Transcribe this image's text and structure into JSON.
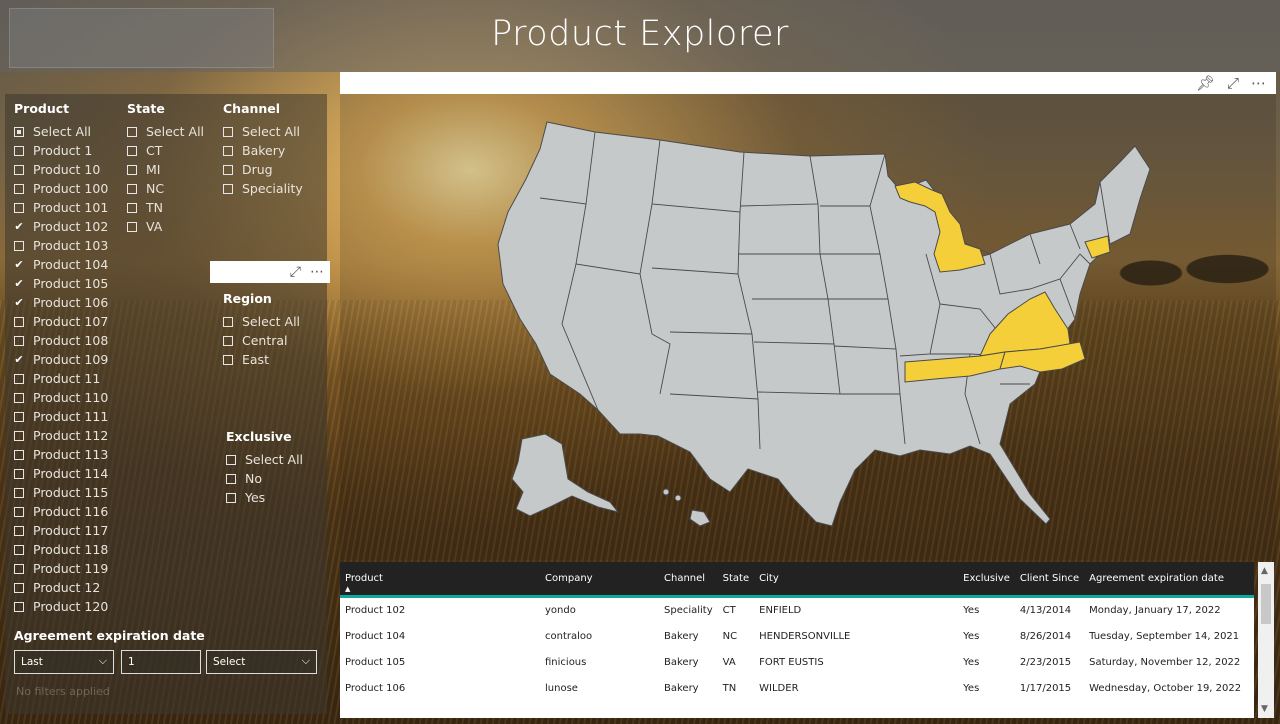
{
  "header": {
    "title": "Product Explorer"
  },
  "slicers": {
    "product": {
      "title": "Product",
      "items": [
        {
          "label": "Select All",
          "state": "partial"
        },
        {
          "label": "Product 1",
          "state": "off"
        },
        {
          "label": "Product 10",
          "state": "off"
        },
        {
          "label": "Product 100",
          "state": "off"
        },
        {
          "label": "Product 101",
          "state": "off"
        },
        {
          "label": "Product 102",
          "state": "on"
        },
        {
          "label": "Product 103",
          "state": "off"
        },
        {
          "label": "Product 104",
          "state": "on"
        },
        {
          "label": "Product 105",
          "state": "on"
        },
        {
          "label": "Product 106",
          "state": "on"
        },
        {
          "label": "Product 107",
          "state": "off"
        },
        {
          "label": "Product 108",
          "state": "off"
        },
        {
          "label": "Product 109",
          "state": "on"
        },
        {
          "label": "Product 11",
          "state": "off"
        },
        {
          "label": "Product 110",
          "state": "off"
        },
        {
          "label": "Product 111",
          "state": "off"
        },
        {
          "label": "Product 112",
          "state": "off"
        },
        {
          "label": "Product 113",
          "state": "off"
        },
        {
          "label": "Product 114",
          "state": "off"
        },
        {
          "label": "Product 115",
          "state": "off"
        },
        {
          "label": "Product 116",
          "state": "off"
        },
        {
          "label": "Product 117",
          "state": "off"
        },
        {
          "label": "Product 118",
          "state": "off"
        },
        {
          "label": "Product 119",
          "state": "off"
        },
        {
          "label": "Product 12",
          "state": "off"
        },
        {
          "label": "Product 120",
          "state": "off"
        }
      ]
    },
    "state": {
      "title": "State",
      "items": [
        {
          "label": "Select All",
          "state": "off"
        },
        {
          "label": "CT",
          "state": "off"
        },
        {
          "label": "MI",
          "state": "off"
        },
        {
          "label": "NC",
          "state": "off"
        },
        {
          "label": "TN",
          "state": "off"
        },
        {
          "label": "VA",
          "state": "off"
        }
      ]
    },
    "channel": {
      "title": "Channel",
      "items": [
        {
          "label": "Select All",
          "state": "off"
        },
        {
          "label": "Bakery",
          "state": "off"
        },
        {
          "label": "Drug",
          "state": "off"
        },
        {
          "label": "Speciality",
          "state": "off"
        }
      ]
    },
    "region": {
      "title": "Region",
      "items": [
        {
          "label": "Select All",
          "state": "off"
        },
        {
          "label": "Central",
          "state": "off"
        },
        {
          "label": "East",
          "state": "off"
        }
      ]
    },
    "exclusive": {
      "title": "Exclusive",
      "items": [
        {
          "label": "Select All",
          "state": "off"
        },
        {
          "label": "No",
          "state": "off"
        },
        {
          "label": "Yes",
          "state": "off"
        }
      ]
    }
  },
  "agreement_filter": {
    "title": "Agreement expiration date",
    "operator": "Last",
    "value": "1",
    "unit_placeholder": "Select",
    "status": "No filters applied"
  },
  "icons": {
    "pin": "pin-icon",
    "focus": "focus-mode-icon",
    "more": "more-options-icon"
  },
  "colors": {
    "highlight_state": "#f5cf3a",
    "base_state": "#c6c9ca",
    "table_header_bg": "#222222",
    "table_accent": "#11a8a0"
  },
  "map": {
    "highlighted_states": [
      "MI",
      "CT",
      "NC",
      "TN",
      "VA"
    ]
  },
  "table": {
    "columns": [
      "Product",
      "Company",
      "Channel",
      "State",
      "City",
      "Exclusive",
      "Client Since",
      "Agreement expiration date"
    ],
    "rows": [
      [
        "Product 102",
        "yondo",
        "Speciality",
        "CT",
        "ENFIELD",
        "Yes",
        "4/13/2014",
        "Monday, January 17, 2022"
      ],
      [
        "Product 104",
        "contraloo",
        "Bakery",
        "NC",
        "HENDERSONVILLE",
        "Yes",
        "8/26/2014",
        "Tuesday, September 14, 2021"
      ],
      [
        "Product 105",
        "finicious",
        "Bakery",
        "VA",
        "FORT EUSTIS",
        "Yes",
        "2/23/2015",
        "Saturday, November 12, 2022"
      ],
      [
        "Product 106",
        "lunose",
        "Bakery",
        "TN",
        "WILDER",
        "Yes",
        "1/17/2015",
        "Wednesday, October 19, 2022"
      ]
    ]
  }
}
